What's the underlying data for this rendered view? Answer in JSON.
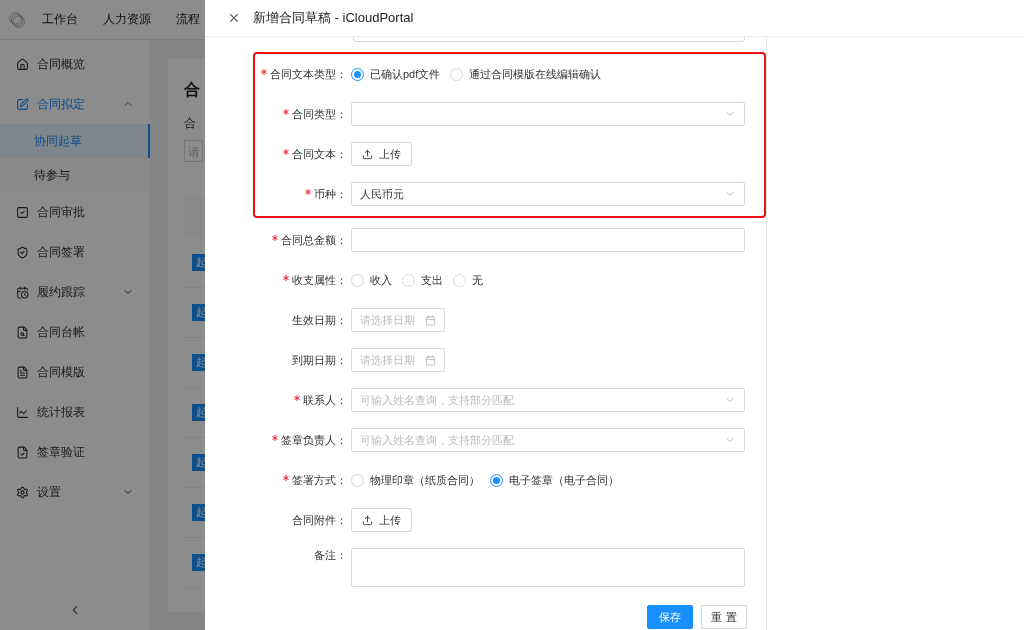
{
  "topnav": {
    "items": [
      "工作台",
      "人力资源",
      "流程"
    ]
  },
  "sidebar": {
    "items": [
      {
        "label": "合同概览",
        "selected": false,
        "expanded": false
      },
      {
        "label": "合同拟定",
        "selected": true,
        "expanded": true,
        "children": [
          {
            "label": "协同起草",
            "selected": true
          },
          {
            "label": "待参与",
            "selected": false
          }
        ]
      },
      {
        "label": "合同审批",
        "selected": false,
        "expanded": false
      },
      {
        "label": "合同签署",
        "selected": false,
        "expanded": false
      },
      {
        "label": "履约跟踪",
        "selected": false,
        "expanded": false,
        "collapsible": true
      },
      {
        "label": "合同台帐",
        "selected": false,
        "expanded": false
      },
      {
        "label": "合同模版",
        "selected": false,
        "expanded": false
      },
      {
        "label": "统计报表",
        "selected": false,
        "expanded": false
      },
      {
        "label": "签章验证",
        "selected": false,
        "expanded": false
      },
      {
        "label": "设置",
        "selected": false,
        "expanded": false,
        "collapsible": true
      }
    ]
  },
  "background_card": {
    "title": "合",
    "filter_label": "合",
    "filter_placeholder": "请",
    "row_badges": [
      "起",
      "起",
      "起",
      "起",
      "起",
      "起",
      "起"
    ]
  },
  "drawer": {
    "title": "新增合同草稿 - iCloudPortal",
    "sections": [
      {
        "highlighted": true,
        "fields": [
          {
            "kind": "radio",
            "label": "合同文本类型：",
            "required": true,
            "options": [
              {
                "label": "已确认pdf文件",
                "selected": true
              },
              {
                "label": "通过合同模版在线编辑确认",
                "selected": false
              }
            ]
          },
          {
            "kind": "select",
            "label": "合同类型：",
            "required": true
          },
          {
            "kind": "upload",
            "label": "合同文本：",
            "required": true,
            "button": "上传"
          },
          {
            "kind": "select",
            "label": "币种：",
            "required": true,
            "value": "人民币元"
          }
        ]
      },
      {
        "highlighted": false,
        "fields": [
          {
            "kind": "input",
            "label": "合同总金额：",
            "required": true
          },
          {
            "kind": "radio",
            "label": "收支属性：",
            "required": true,
            "options": [
              {
                "label": "收入",
                "selected": false
              },
              {
                "label": "支出",
                "selected": false
              },
              {
                "label": "无",
                "selected": false
              }
            ]
          },
          {
            "kind": "date",
            "label": "生效日期：",
            "required": false,
            "placeholder": "请选择日期"
          },
          {
            "kind": "date",
            "label": "到期日期：",
            "required": false,
            "placeholder": "请选择日期"
          },
          {
            "kind": "select",
            "label": "联系人：",
            "required": true,
            "placeholder": "可输入姓名查询，支持部分匹配"
          },
          {
            "kind": "select",
            "label": "签章负责人：",
            "required": true,
            "placeholder": "可输入姓名查询，支持部分匹配"
          },
          {
            "kind": "radio",
            "label": "签署方式：",
            "required": true,
            "options": [
              {
                "label": "物理印章（纸质合同）",
                "selected": false
              },
              {
                "label": "电子签章（电子合同）",
                "selected": true
              }
            ]
          },
          {
            "kind": "upload",
            "label": "合同附件：",
            "required": false,
            "button": "上传"
          },
          {
            "kind": "textarea",
            "label": "备注：",
            "required": false
          }
        ]
      }
    ],
    "buttons": [
      {
        "label": "保存",
        "kind": "primary"
      },
      {
        "label": "重 置",
        "kind": "default"
      }
    ]
  }
}
